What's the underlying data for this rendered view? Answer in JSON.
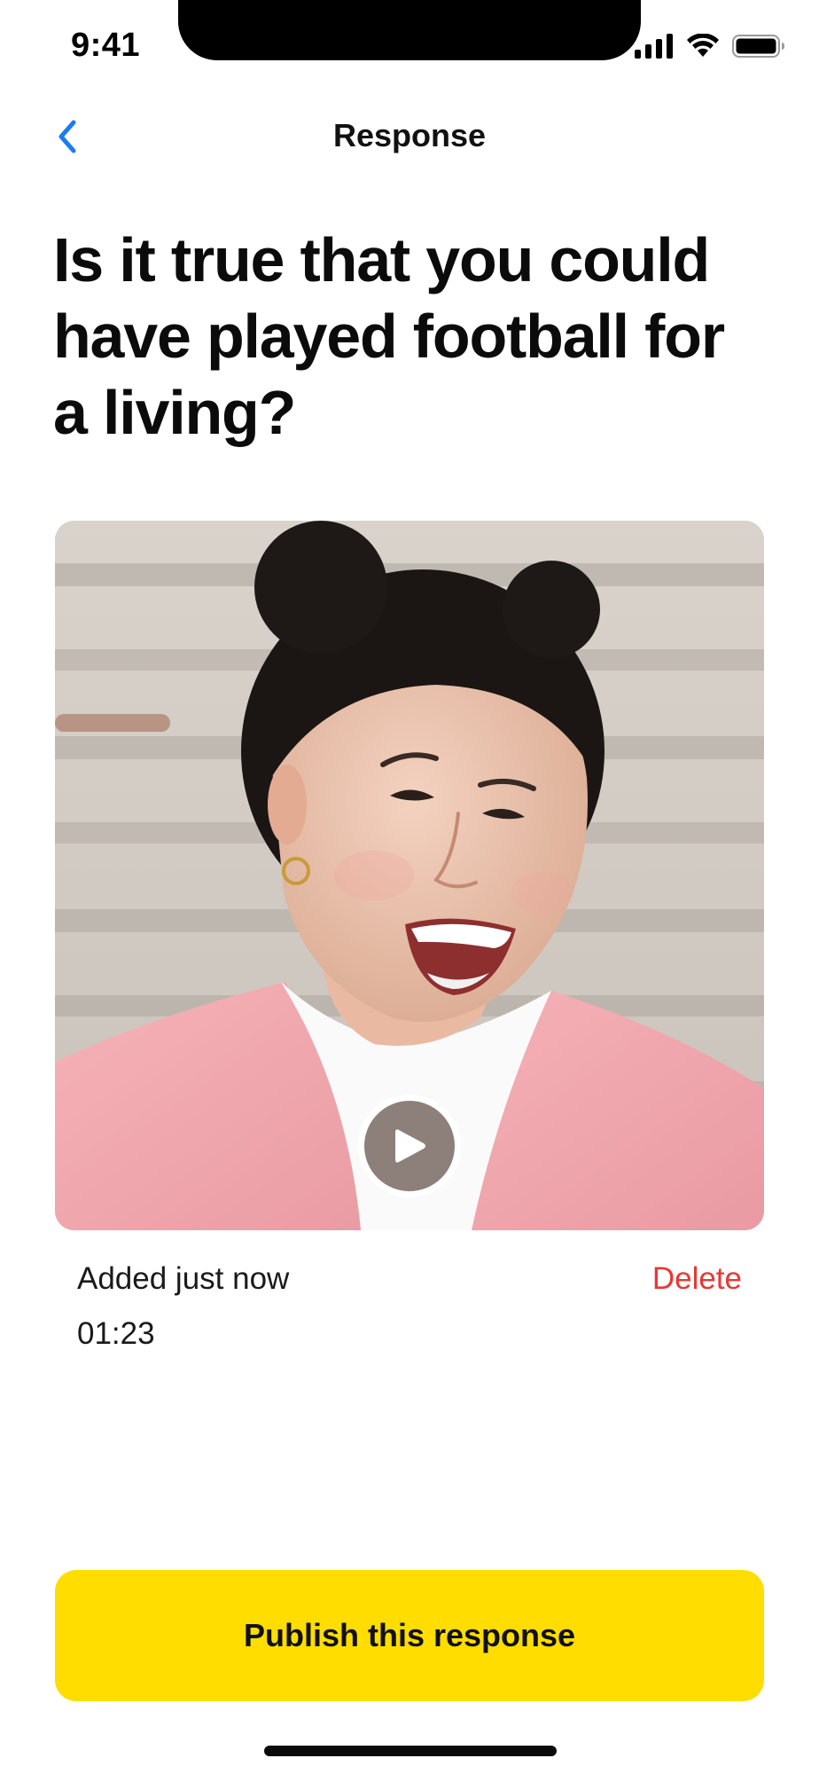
{
  "status_bar": {
    "time": "9:41",
    "icons": [
      "cellular-signal-icon",
      "wifi-icon",
      "battery-icon"
    ]
  },
  "nav": {
    "title": "Response",
    "back_icon": "chevron-left-icon",
    "accent_color": "#1a7cf2"
  },
  "question": {
    "text": "Is it true that you could have played football for a living?"
  },
  "video": {
    "thumbnail_subject": "photo",
    "play_icon": "play-icon"
  },
  "meta": {
    "added_label": "Added just now",
    "duration": "01:23",
    "delete_label": "Delete",
    "delete_color": "#e53935"
  },
  "publish": {
    "label": "Publish this response",
    "color": "#ffdd00"
  }
}
